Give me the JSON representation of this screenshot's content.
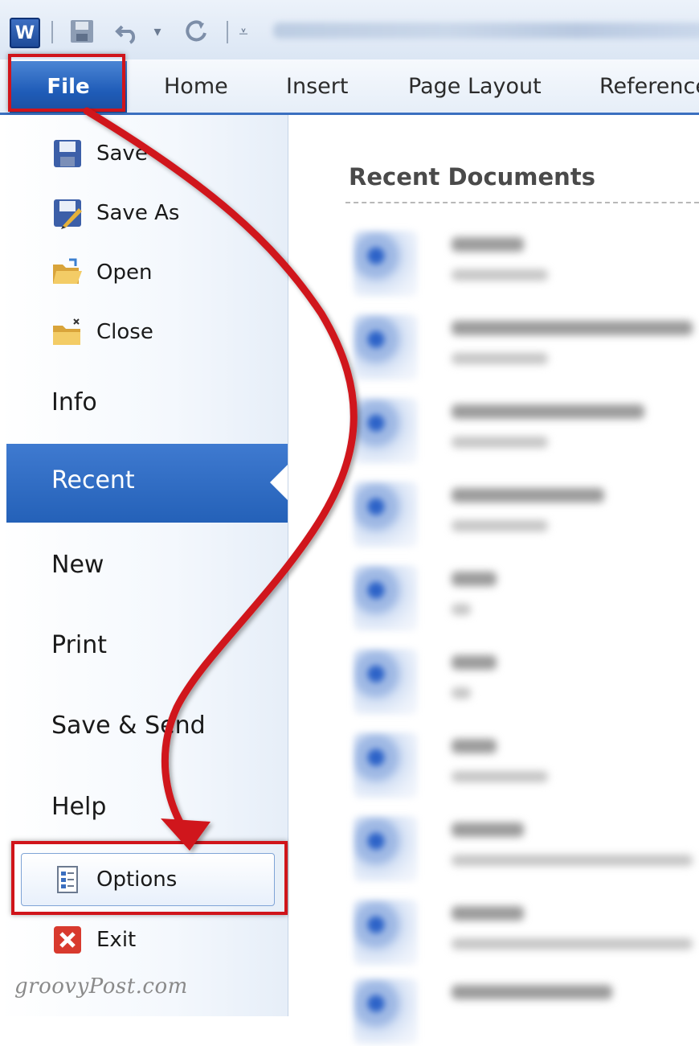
{
  "quick_access": {
    "app_icon_letter": "W",
    "icons": [
      "word-icon",
      "save-icon",
      "undo-icon",
      "dropdown-icon",
      "redo-icon",
      "customize-icon"
    ]
  },
  "ribbon": {
    "tabs": [
      {
        "label": "File"
      },
      {
        "label": "Home"
      },
      {
        "label": "Insert"
      },
      {
        "label": "Page Layout"
      },
      {
        "label": "Reference"
      }
    ]
  },
  "backstage": {
    "commands": [
      {
        "label": "Save",
        "icon": "save-icon"
      },
      {
        "label": "Save As",
        "icon": "save-as-icon"
      },
      {
        "label": "Open",
        "icon": "open-folder-icon"
      },
      {
        "label": "Close",
        "icon": "close-folder-icon"
      }
    ],
    "tabs": [
      {
        "label": "Info"
      },
      {
        "label": "Recent"
      },
      {
        "label": "New"
      },
      {
        "label": "Print"
      },
      {
        "label": "Save & Send"
      },
      {
        "label": "Help"
      }
    ],
    "options_label": "Options",
    "exit_label": "Exit"
  },
  "recent_documents": {
    "title": "Recent Documents"
  },
  "watermark": "groovyPost.com",
  "colors": {
    "file_tab": "#1f5cb8",
    "selected_tab": "#2f6cc4",
    "highlight_red": "#d0141a"
  }
}
